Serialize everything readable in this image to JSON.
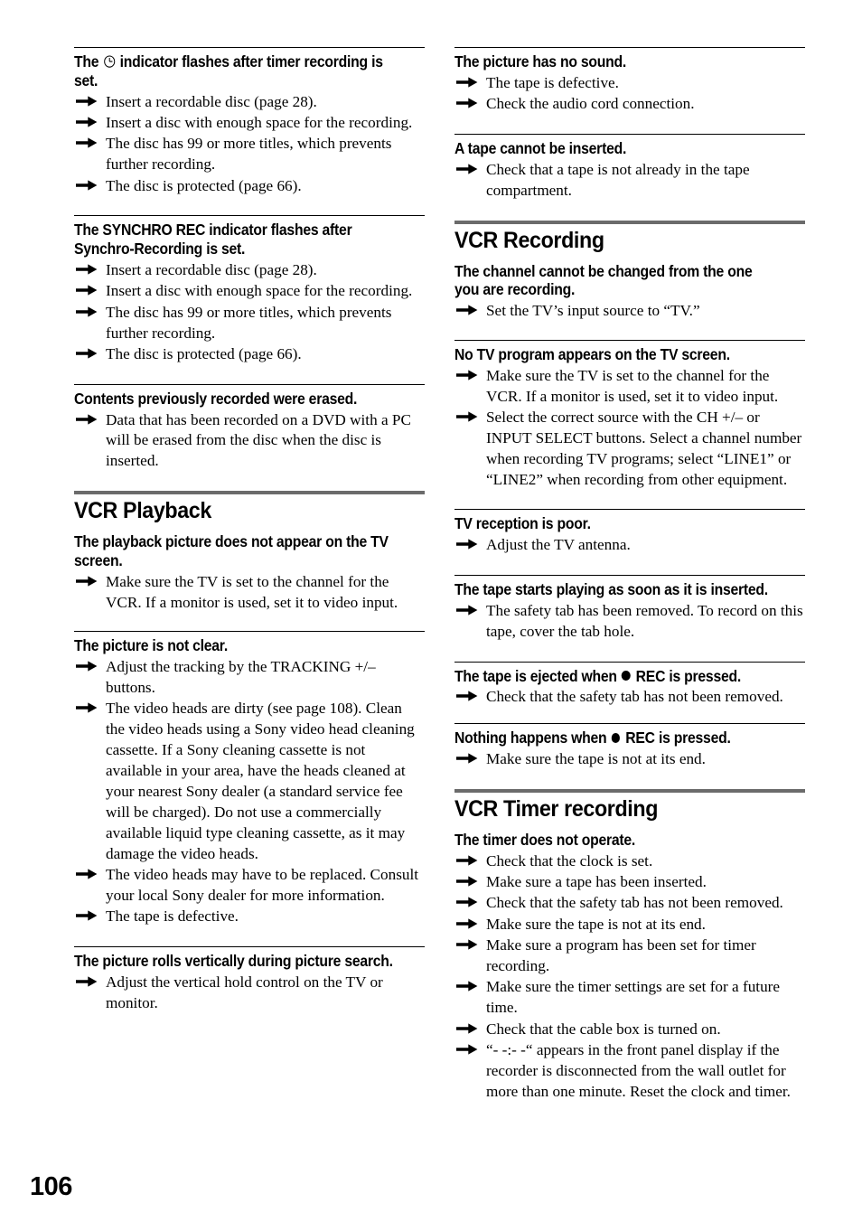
{
  "page": {
    "number": "106",
    "arrow_icon": "right-arrow-bullet",
    "rule_color": "#000000",
    "section_bar_color": "#6b6b6b",
    "text_color": "#000000",
    "background_color": "#ffffff"
  },
  "left_column": {
    "blocks": [
      {
        "type": "qa",
        "title_parts": [
          "The ",
          "clock-indicator-icon",
          " indicator flashes after timer recording is set."
        ],
        "title": "The ⊙ indicator flashes after timer recording is set.",
        "title_pre": "The ",
        "title_post": " indicator flashes after timer recording is set.",
        "answers": [
          "Insert a recordable disc (page 28).",
          "Insert a disc with enough space for the recording.",
          "The disc has 99 or more titles, which prevents further recording.",
          "The disc is protected (page 66)."
        ]
      },
      {
        "type": "qa",
        "title": "The SYNCHRO REC indicator flashes after Synchro-Recording is set.",
        "answers": [
          "Insert a recordable disc (page 28).",
          "Insert a disc with enough space for the recording.",
          "The disc has 99 or more titles, which prevents further recording.",
          "The disc is protected (page 66)."
        ]
      },
      {
        "type": "qa",
        "title": "Contents previously recorded were erased.",
        "answers": [
          "Data that has been recorded on a DVD with a PC will be erased from the disc when the disc is inserted."
        ]
      },
      {
        "type": "section",
        "title": "VCR Playback"
      },
      {
        "type": "qa-nodivider",
        "title": "The playback picture does not appear on the TV screen.",
        "answers": [
          "Make sure the TV is set to the channel for the VCR. If a monitor is used, set it to video input."
        ]
      },
      {
        "type": "qa",
        "title": "The picture is not clear.",
        "answers": [
          "Adjust the tracking by the TRACKING +/– buttons.",
          "The video heads are dirty (see page 108). Clean the video heads using a Sony video head cleaning cassette. If a Sony cleaning cassette is not available in your area, have the heads cleaned at your nearest Sony dealer (a standard service fee will be charged). Do not use a commercially available liquid type cleaning cassette, as it may damage the video heads.",
          "The video heads may have to be replaced. Consult your local Sony dealer for more information.",
          "The tape is defective."
        ]
      },
      {
        "type": "qa",
        "title": "The picture rolls vertically during picture search.",
        "answers": [
          "Adjust the vertical hold control on the TV or monitor."
        ]
      }
    ]
  },
  "right_column": {
    "blocks": [
      {
        "type": "qa",
        "title": "The picture has no sound.",
        "answers": [
          "The tape is defective.",
          "Check the audio cord connection."
        ]
      },
      {
        "type": "qa",
        "title": "A tape cannot be inserted.",
        "answers": [
          "Check that a tape is not already in the tape compartment."
        ]
      },
      {
        "type": "section",
        "title": "VCR Recording"
      },
      {
        "type": "qa-nodivider",
        "title": "The channel cannot be changed from the one you are recording.",
        "answers": [
          "Set the TV’s input source to “TV.”"
        ]
      },
      {
        "type": "qa",
        "title": "No TV program appears on the TV screen.",
        "answers": [
          "Make sure the TV is set to the channel for the VCR. If a monitor is used, set it to video input.",
          "Select the correct source with the CH +/– or INPUT SELECT buttons. Select a channel number when recording TV programs; select “LINE1” or “LINE2” when recording from other equipment."
        ]
      },
      {
        "type": "qa",
        "title": "TV reception is poor.",
        "answers": [
          "Adjust the TV antenna."
        ]
      },
      {
        "type": "qa",
        "title": "The tape starts playing as soon as it is inserted.",
        "answers": [
          "The safety tab has been removed. To record on this tape, cover the tab hole."
        ]
      },
      {
        "type": "qa",
        "title_pre": "The tape is ejected when ",
        "title_post": " REC is pressed.",
        "title": "The tape is ejected when ● REC is pressed.",
        "answers": [
          "Check that the safety tab has not been removed."
        ]
      },
      {
        "type": "qa",
        "title_pre": "Nothing happens when ",
        "title_post": " REC is pressed.",
        "title": "Nothing happens when ● REC is pressed.",
        "answers": [
          "Make sure the tape is not at its end."
        ]
      },
      {
        "type": "section",
        "title": "VCR Timer recording"
      },
      {
        "type": "qa-nodivider",
        "title": "The timer does not operate.",
        "answers": [
          "Check that the clock is set.",
          "Make sure a tape has been inserted.",
          "Check that the safety tab has not been removed.",
          "Make sure the tape is not at its end.",
          "Make sure a program has been set for timer recording.",
          "Make sure the timer settings are set for a future time.",
          "Check that the cable box is turned on.",
          "“- -:- -“ appears in the front panel display if the recorder is disconnected from the wall outlet for more than one minute. Reset the clock and timer."
        ]
      }
    ]
  }
}
